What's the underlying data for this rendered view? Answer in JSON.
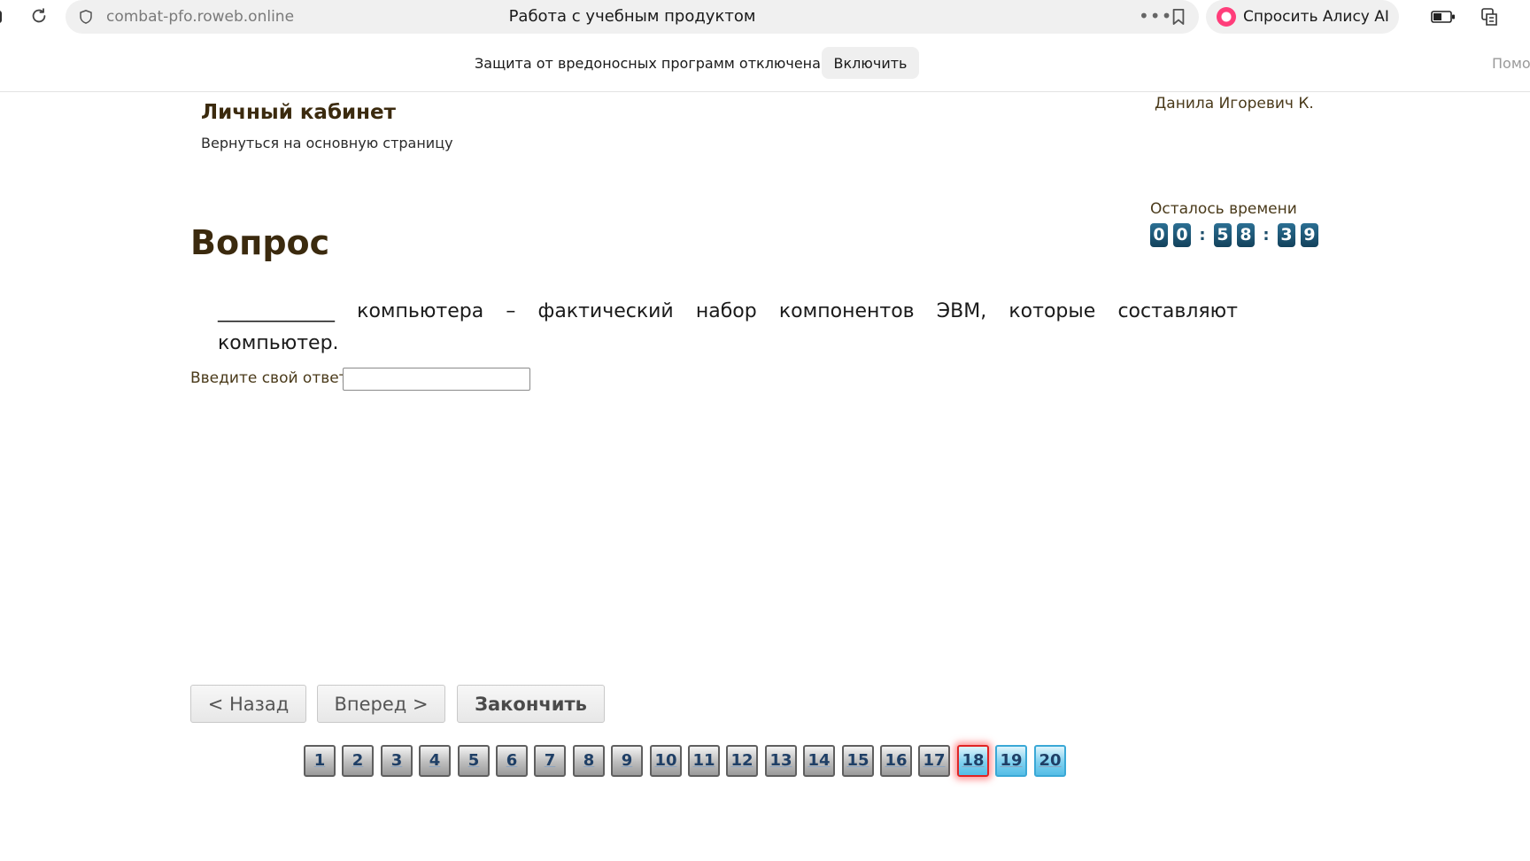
{
  "browser": {
    "url": "combat-pfo.roweb.online",
    "page_title": "Работа с учебным продуктом",
    "alice_label": "Спросить Алису AI",
    "accent_color": "#ff3d7a"
  },
  "notice": {
    "text": "Защита от вредоносных программ отключена",
    "enable_label": "Включить",
    "help_clipped": "Помо"
  },
  "header": {
    "cabinet_title": "Личный кабинет",
    "back_link": "Вернуться на основную страницу",
    "user_name": "Данила Игоревич К."
  },
  "timer": {
    "label": "Осталось времени",
    "digits": [
      "0",
      "0",
      "5",
      "8",
      "3",
      "9"
    ]
  },
  "question": {
    "heading": "Вопрос",
    "text": "____________ компьютера – фактический набор компонентов ЭВМ, которые составляют компьютер.",
    "answer_label": "Введите свой ответ",
    "answer_value": ""
  },
  "navigation": {
    "back_label": "< Назад",
    "forward_label": "Вперед >",
    "finish_label": "Закончить"
  },
  "pager": {
    "items": [
      "1",
      "2",
      "3",
      "4",
      "5",
      "6",
      "7",
      "8",
      "9",
      "10",
      "11",
      "12",
      "13",
      "14",
      "15",
      "16",
      "17",
      "18",
      "19",
      "20"
    ],
    "current": "18",
    "visited": [
      "19",
      "20"
    ]
  }
}
